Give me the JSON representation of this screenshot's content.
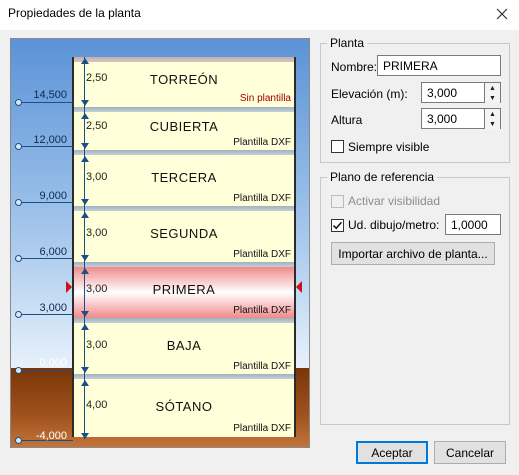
{
  "window": {
    "title": "Propiedades de la planta",
    "close_icon": "close-icon"
  },
  "building": {
    "floors": [
      {
        "name": "TORREÓN",
        "height": "2,50",
        "template": "Sin plantilla",
        "selected": false
      },
      {
        "name": "CUBIERTA",
        "height": "2,50",
        "template": "Plantilla DXF",
        "selected": false
      },
      {
        "name": "TERCERA",
        "height": "3,00",
        "template": "Plantilla DXF",
        "selected": false
      },
      {
        "name": "SEGUNDA",
        "height": "3,00",
        "template": "Plantilla DXF",
        "selected": false
      },
      {
        "name": "PRIMERA",
        "height": "3,00",
        "template": "Plantilla DXF",
        "selected": true
      },
      {
        "name": "BAJA",
        "height": "3,00",
        "template": "Plantilla DXF",
        "selected": false
      },
      {
        "name": "SÓTANO",
        "height": "4,00",
        "template": "Plantilla DXF",
        "selected": false
      }
    ],
    "levels": [
      "14,500",
      "12,000",
      "9,000",
      "6,000",
      "3,000",
      "0,000",
      "-4,000"
    ],
    "colors": {
      "sky_top": "#5b92d6",
      "ground": "#8b4513",
      "floor_fill": "#ffffd9",
      "selected_fill": "#f08a8a",
      "dimension": "#1b4f8a",
      "marker": "#d01010"
    }
  },
  "planta": {
    "title": "Planta",
    "nombre_label": "Nombre:",
    "nombre_value": "PRIMERA",
    "elevacion_label": "Elevación (m):",
    "elevacion_value": "3,000",
    "altura_label": "Altura",
    "altura_value": "3,000",
    "siempre_visible_label": "Siempre visible",
    "siempre_visible_checked": false
  },
  "referencia": {
    "title": "Plano de referencia",
    "activar_label": "Activar visibilidad",
    "activar_checked": false,
    "ud_dibujo_label": "Ud. dibujo/metro:",
    "ud_dibujo_checked": true,
    "ud_dibujo_value": "1,0000",
    "importar_label": "Importar archivo de planta..."
  },
  "buttons": {
    "accept": "Aceptar",
    "cancel": "Cancelar"
  }
}
